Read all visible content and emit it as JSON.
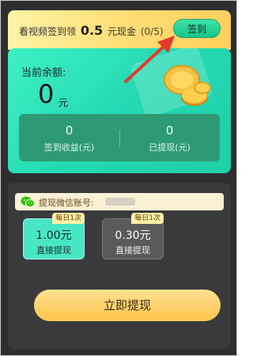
{
  "banner": {
    "text_prefix": "看视频签到领",
    "amount": "0.5",
    "text_suffix": "元现金",
    "count": "(0/5)",
    "sign_button": "签到"
  },
  "balance": {
    "label": "当前余额:",
    "value": "0",
    "unit": "元"
  },
  "stats": {
    "earned_value": "0",
    "earned_label": "签到收益(元)",
    "withdrawn_value": "0",
    "withdrawn_label": "已提现(元)"
  },
  "withdraw": {
    "wechat_label": "提现微信账号:",
    "options": [
      {
        "tag": "每日1次",
        "price": "1.00元",
        "subtitle": "直接提现"
      },
      {
        "tag": "每日1次",
        "price": "0.30元",
        "subtitle": "直接提现"
      }
    ],
    "button": "立即提现"
  },
  "icons": {
    "arrow": "red-arrow-icon",
    "coins": "coin-stack-icon",
    "wechat": "wechat-icon"
  },
  "colors": {
    "accent_green": "#24d9b3",
    "accent_yellow": "#ffc54e",
    "arrow_red": "#e33a2b"
  }
}
